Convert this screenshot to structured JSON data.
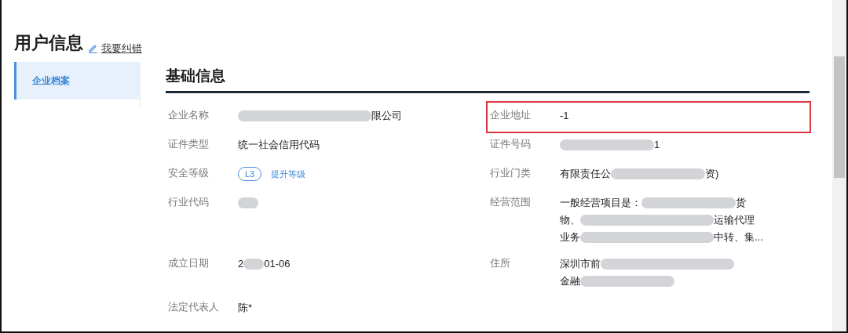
{
  "page_title": "用户信息",
  "edit_link": "我要纠错",
  "sidebar": {
    "items": [
      {
        "label": "企业档案",
        "selected": true
      }
    ]
  },
  "section_title": "基础信息",
  "rows": [
    {
      "left": {
        "label": "企业名称",
        "highlighted": false,
        "lines": [
          [
            {
              "kind": "blur-long"
            },
            {
              "kind": "text",
              "text": "限公司"
            }
          ]
        ]
      },
      "right": {
        "label": "企业地址",
        "highlighted": true,
        "lines": [
          [
            {
              "kind": "text",
              "text": "-1"
            }
          ]
        ]
      }
    },
    {
      "left": {
        "label": "证件类型",
        "highlighted": false,
        "lines": [
          [
            {
              "kind": "text",
              "text": "统一社会信用代码"
            }
          ]
        ]
      },
      "right": {
        "label": "证件号码",
        "highlighted": false,
        "lines": [
          [
            {
              "kind": "blur-mid"
            },
            {
              "kind": "text",
              "text": "1"
            }
          ]
        ]
      }
    },
    {
      "left": {
        "label": "安全等级",
        "highlighted": false,
        "lines": [
          [
            {
              "kind": "badge",
              "text": "L3"
            },
            {
              "kind": "link",
              "text": "提升等级"
            }
          ]
        ]
      },
      "right": {
        "label": "行业门类",
        "highlighted": false,
        "lines": [
          [
            {
              "kind": "text",
              "text": "有限责任公"
            },
            {
              "kind": "blur-mid"
            },
            {
              "kind": "text",
              "text": "资)"
            }
          ]
        ]
      }
    },
    {
      "left": {
        "label": "行业代码",
        "highlighted": false,
        "lines": [
          [
            {
              "kind": "blur-short"
            }
          ]
        ]
      },
      "right": {
        "label": "经营范围",
        "highlighted": false,
        "lines": [
          [
            {
              "kind": "text",
              "text": "一般经营项目是："
            },
            {
              "kind": "blur-mid"
            },
            {
              "kind": "text",
              "text": "货"
            }
          ],
          [
            {
              "kind": "text",
              "text": "物、"
            },
            {
              "kind": "blur-long"
            },
            {
              "kind": "text",
              "text": "运输代理"
            }
          ],
          [
            {
              "kind": "text",
              "text": "业务"
            },
            {
              "kind": "blur-long"
            },
            {
              "kind": "text",
              "text": "中转、集..."
            }
          ]
        ]
      }
    },
    {
      "left": {
        "label": "成立日期",
        "highlighted": false,
        "lines": [
          [
            {
              "kind": "text",
              "text": "2"
            },
            {
              "kind": "blur-short"
            },
            {
              "kind": "text",
              "text": "01-06"
            }
          ]
        ]
      },
      "right": {
        "label": "住所",
        "highlighted": false,
        "lines": [
          [
            {
              "kind": "text",
              "text": "深圳市前"
            },
            {
              "kind": "blur-long"
            }
          ],
          [
            {
              "kind": "text",
              "text": "金融"
            },
            {
              "kind": "blur-mid"
            }
          ]
        ]
      }
    },
    {
      "left": {
        "label": "法定代表人",
        "highlighted": false,
        "lines": [
          [
            {
              "kind": "text",
              "text": "陈*"
            }
          ]
        ]
      }
    }
  ]
}
